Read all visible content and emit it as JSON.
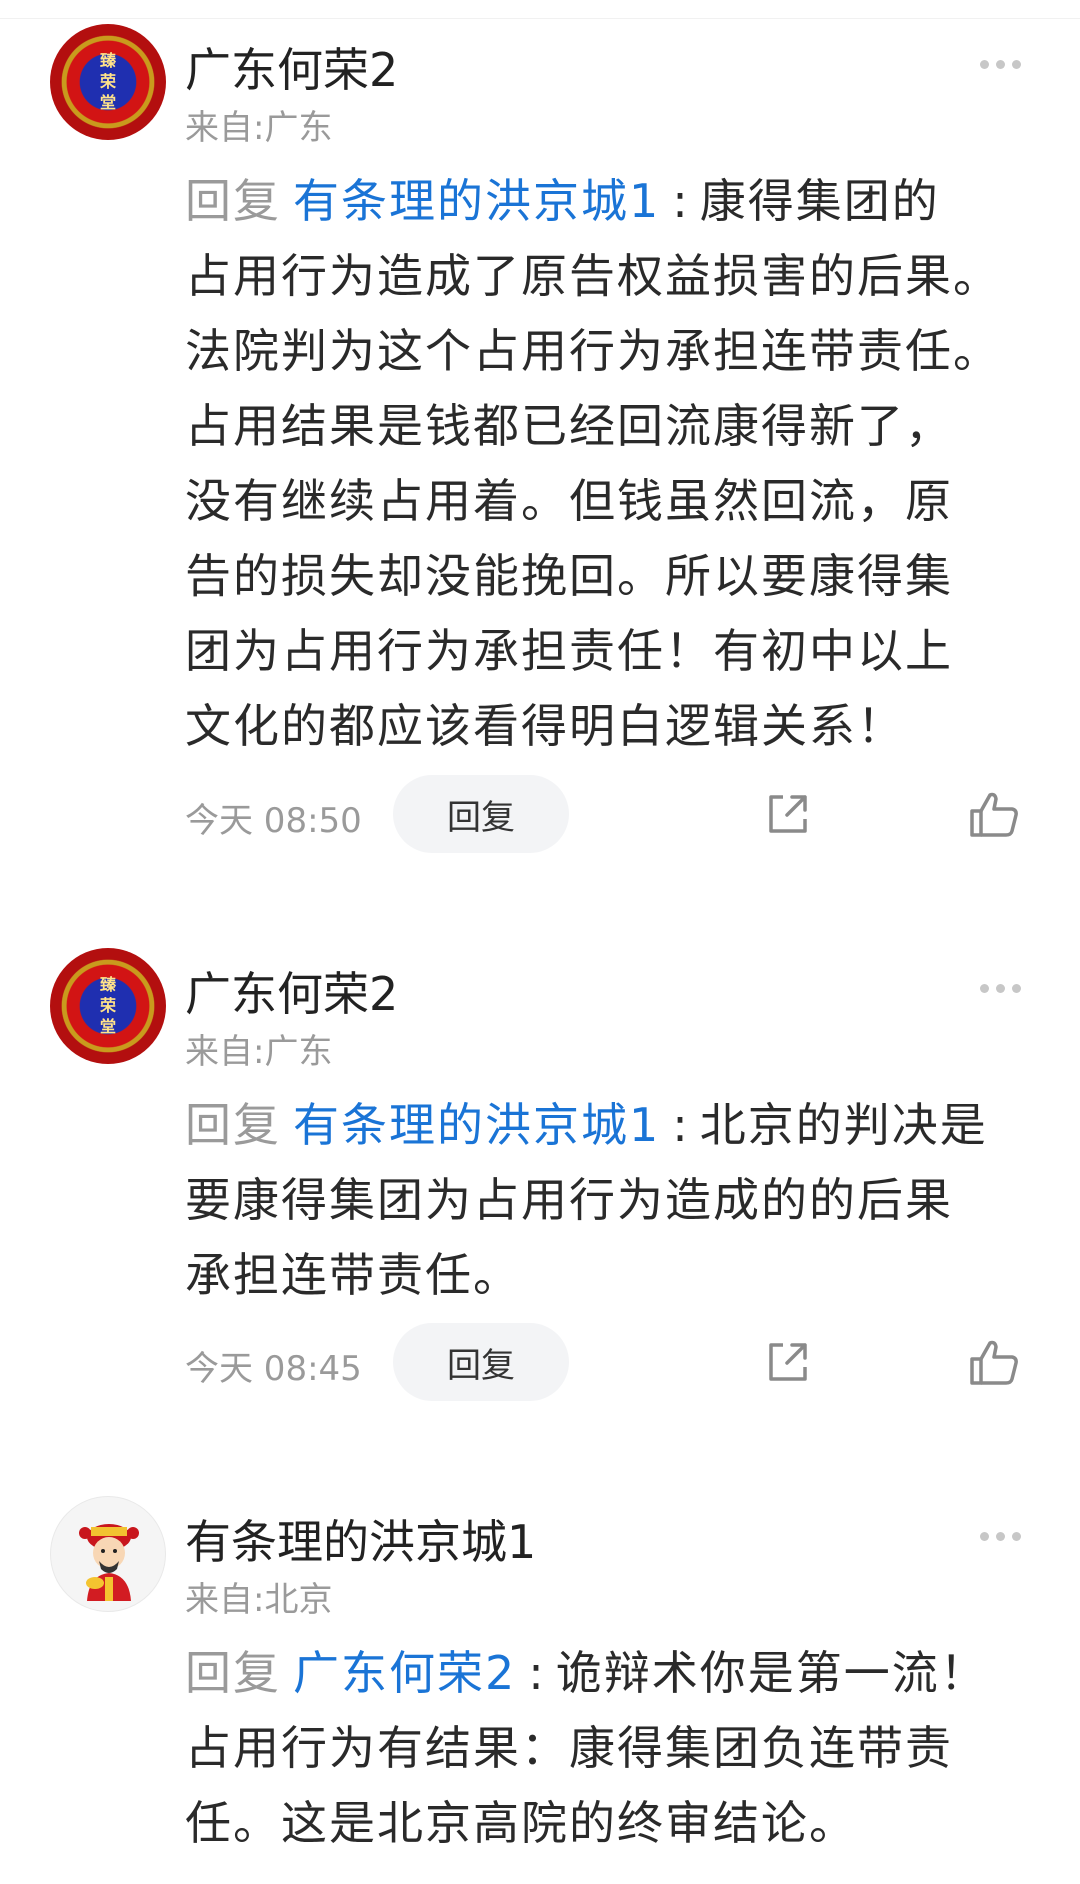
{
  "comments": [
    {
      "username": "广东何荣2",
      "location": "来自:广东",
      "avatar_text": [
        "臻",
        "荣",
        "堂"
      ],
      "reply_prefix": "回复",
      "mention": "有条理的洪京城1",
      "colon": ":",
      "lines": [
        "康得集团的",
        "占用行为造成了原告权益损害的后果。",
        "法院判为这个占用行为承担连带责任。",
        "占用结果是钱都已经回流康得新了，",
        "没有继续占用着。但钱虽然回流，原",
        "告的损失却没能挽回。所以要康得集",
        "团为占用行为承担责任！有初中以上",
        "文化的都应该看得明白逻辑关系！"
      ],
      "time": "今天 08:50",
      "reply_button": "回复"
    },
    {
      "username": "广东何荣2",
      "location": "来自:广东",
      "avatar_text": [
        "臻",
        "荣",
        "堂"
      ],
      "reply_prefix": "回复",
      "mention": "有条理的洪京城1",
      "colon": ":",
      "lines": [
        "北京的判决是",
        "要康得集团为占用行为造成的的后果",
        "承担连带责任。"
      ],
      "time": "今天 08:45",
      "reply_button": "回复"
    },
    {
      "username": "有条理的洪京城1",
      "location": "来自:北京",
      "reply_prefix": "回复",
      "mention": "广东何荣2",
      "colon": ":",
      "lines": [
        "诡辩术你是第一流！",
        "占用行为有结果：康得集团负连带责",
        "任。这是北京高院的终审结论。"
      ]
    }
  ],
  "colors": {
    "mention": "#1a74d6",
    "secondary_text": "#9a9a9a",
    "reply_button_bg": "#f3f4f6"
  },
  "icons": [
    "more-icon",
    "share-icon",
    "like-icon"
  ]
}
